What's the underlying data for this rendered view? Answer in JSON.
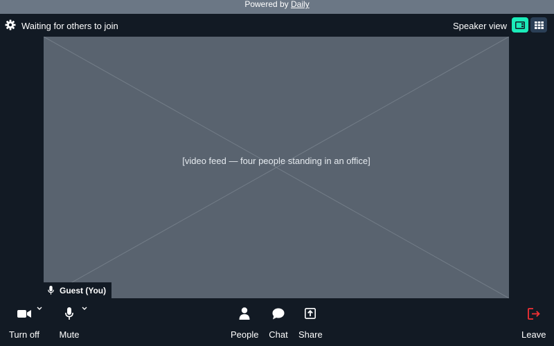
{
  "banner": {
    "prefix": "Powered by ",
    "brand": "Daily"
  },
  "topbar": {
    "status": "Waiting for others to join",
    "view_label": "Speaker view"
  },
  "video": {
    "placeholder_caption": "[video feed — four people standing in an office]"
  },
  "participant": {
    "name": "Guest (You)"
  },
  "tray": {
    "camera_label": "Turn off",
    "mic_label": "Mute",
    "people_label": "People",
    "chat_label": "Chat",
    "share_label": "Share",
    "leave_label": "Leave"
  },
  "colors": {
    "background": "#121a24",
    "banner": "#6b7785",
    "active_view": "#1bebb9",
    "inactive_view": "#2b3f56",
    "leave": "#f63135"
  },
  "icons": [
    "gear-icon",
    "speaker-view-icon",
    "grid-view-icon",
    "microphone-icon",
    "camera-icon",
    "chevron-down-icon",
    "people-icon",
    "chat-icon",
    "share-icon",
    "leave-icon"
  ]
}
